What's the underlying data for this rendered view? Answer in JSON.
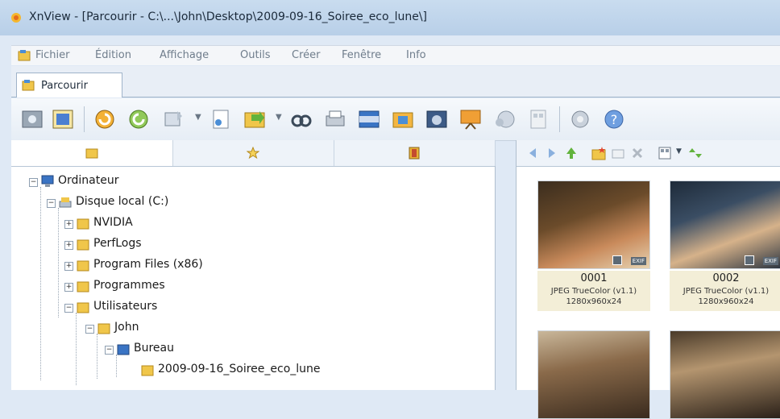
{
  "window": {
    "title": "XnView - [Parcourir - C:\\...\\John\\Desktop\\2009-09-16_Soiree_eco_lune\\]"
  },
  "menu": [
    "Fichier",
    "Édition",
    "Affichage",
    "Outils",
    "Créer",
    "Fenêtre",
    "Info"
  ],
  "tab": {
    "label": "Parcourir"
  },
  "toolbar": [
    "view-icon",
    "fullscreen-icon",
    "rotate-left-icon",
    "rotate-right-icon",
    "transform-icon",
    "properties-icon",
    "convert-icon",
    "find-icon",
    "print-icon",
    "filmstrip-icon",
    "batch-icon",
    "capture-icon",
    "slideshow-icon",
    "web-icon",
    "contact-sheet-icon",
    "settings-icon",
    "help-icon"
  ],
  "tree": [
    {
      "label": "Ordinateur",
      "icon": "computer-icon"
    },
    {
      "label": "Disque local (C:)",
      "icon": "drive-icon"
    },
    {
      "label": "NVIDIA",
      "icon": "folder-icon"
    },
    {
      "label": "PerfLogs",
      "icon": "folder-icon"
    },
    {
      "label": "Program Files (x86)",
      "icon": "folder-icon"
    },
    {
      "label": "Programmes",
      "icon": "folder-icon"
    },
    {
      "label": "Utilisateurs",
      "icon": "folder-icon"
    },
    {
      "label": "John",
      "icon": "folder-icon"
    },
    {
      "label": "Bureau",
      "icon": "desktop-folder-icon"
    },
    {
      "label": "2009-09-16_Soiree_eco_lune",
      "icon": "folder-icon"
    }
  ],
  "thumbs": [
    {
      "name": "0001",
      "info": "JPEG TrueColor (v1.1)",
      "dims": "1280x960x24",
      "badge": "EXIF"
    },
    {
      "name": "0002",
      "info": "JPEG TrueColor (v1.1)",
      "dims": "1280x960x24",
      "badge": "EXIF"
    }
  ],
  "colors": {
    "accent": "#3a74c4",
    "folder": "#f0c64a"
  }
}
